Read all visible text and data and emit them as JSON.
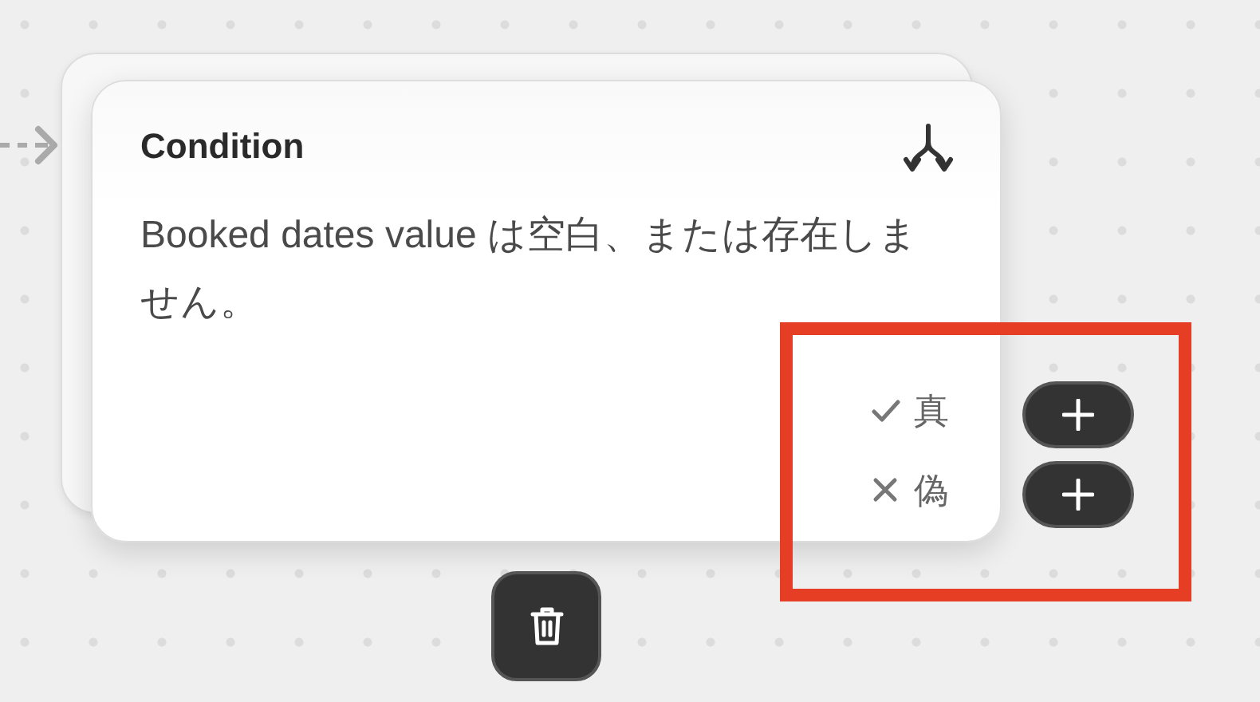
{
  "node": {
    "title": "Condition",
    "description": "Booked dates value は空白、または存在しません。",
    "branches": [
      {
        "kind": "true",
        "label": "真"
      },
      {
        "kind": "false",
        "label": "偽"
      }
    ]
  }
}
